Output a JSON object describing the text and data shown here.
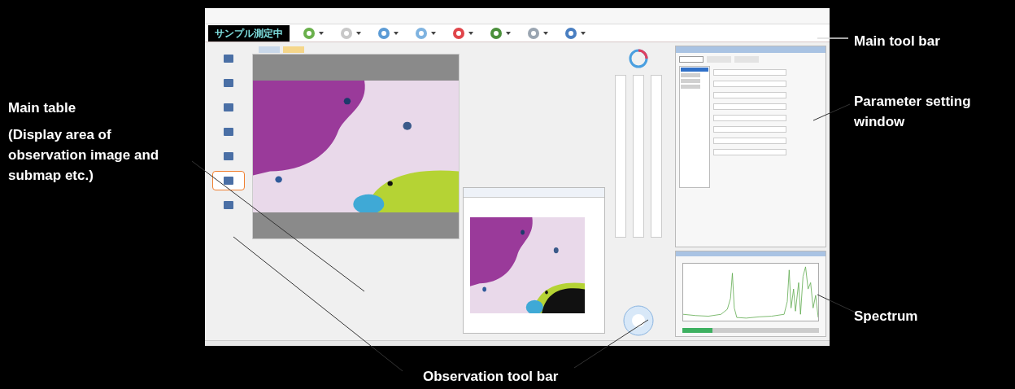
{
  "toolbar": {
    "status_badge": "サンプル測定中",
    "tools": [
      {
        "color": "#6ab04c"
      },
      {
        "color": "#c8c8c8"
      },
      {
        "color": "#5b9bd5"
      },
      {
        "color": "#7fb3e0"
      },
      {
        "color": "#e0454a"
      },
      {
        "color": "#4a8f3a"
      },
      {
        "color": "#9aa5b1"
      },
      {
        "color": "#4a7fc1"
      }
    ]
  },
  "sidebar_tools": [
    {
      "selected": false
    },
    {
      "selected": false
    },
    {
      "selected": false
    },
    {
      "selected": false
    },
    {
      "selected": false
    },
    {
      "selected": true
    },
    {
      "selected": false
    }
  ],
  "image_tabs": [
    {
      "selected": false
    },
    {
      "selected": true
    }
  ],
  "parameter_window": {
    "tabs": [
      {
        "selected": true
      },
      {
        "selected": false
      },
      {
        "selected": false
      }
    ],
    "list_items": [
      {
        "selected": true
      },
      {
        "selected": false
      },
      {
        "selected": false
      },
      {
        "selected": false
      }
    ]
  },
  "spectrum_panel": {
    "progress": {
      "level": 0.22
    }
  },
  "callouts": [
    {
      "kind": "right",
      "text": "Main tool bar"
    },
    {
      "kind": "left",
      "text": "Main table",
      "note": "(Display area of observation image and submap etc.)"
    },
    {
      "kind": "right",
      "text": "Parameter setting window"
    },
    {
      "kind": "right",
      "text": "Spectrum"
    },
    {
      "kind": "bottom",
      "text": "Observation tool bar"
    }
  ]
}
